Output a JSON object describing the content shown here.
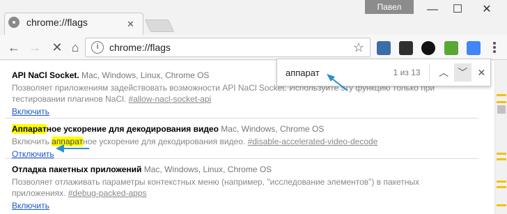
{
  "window": {
    "profile_name": "Павел",
    "minimize": "—",
    "maximize": "☐",
    "close": "✕"
  },
  "tab": {
    "title": "chrome://flags",
    "close": "✕"
  },
  "toolbar": {
    "back": "←",
    "forward": "→",
    "reload": "↻",
    "omnibox_scheme": "chrome://",
    "omnibox_path": "flags",
    "star": "☆",
    "extensions": [
      "ext-1-icon",
      "ext-2-icon",
      "ext-3-icon",
      "ext-4-icon",
      "ext-5-icon"
    ]
  },
  "findbar": {
    "query": "аппарат",
    "count": "1 из 13",
    "prev": "︿",
    "next": "﹀",
    "close": "✕"
  },
  "flags": [
    {
      "title": "API NaCl Socket.",
      "platforms": "Mac, Windows, Linux, Chrome OS",
      "description": "Позволяет приложениям задействовать возможности API NaCl Socket. Используйте эту функцию только при тестировании плагинов NaCl.",
      "hash": "#allow-nacl-socket-api",
      "action": "Включить"
    },
    {
      "title_hl": "Аппарат",
      "title_rest": "ное ускорение для декодирования видео",
      "platforms": "Mac, Windows, Chrome OS",
      "desc_before": "Включить ",
      "desc_hl": "аппарат",
      "desc_after": "ное ускорение для декодирования видео. ",
      "hash": "#disable-accelerated-video-decode",
      "action": "Отключить"
    },
    {
      "title": "Отладка пакетных приложений",
      "platforms": "Mac, Windows, Linux, Chrome OS",
      "description": "Позволяет отлаживать параметры контекстных меню (например, \"исследование элементов\") в пакетных приложениях. ",
      "hash": "#debug-packed-apps",
      "action": "Включить"
    }
  ],
  "colors": {
    "highlight": "#ffff00",
    "arrow": "#2a8fd6",
    "link": "#1a56c9"
  }
}
